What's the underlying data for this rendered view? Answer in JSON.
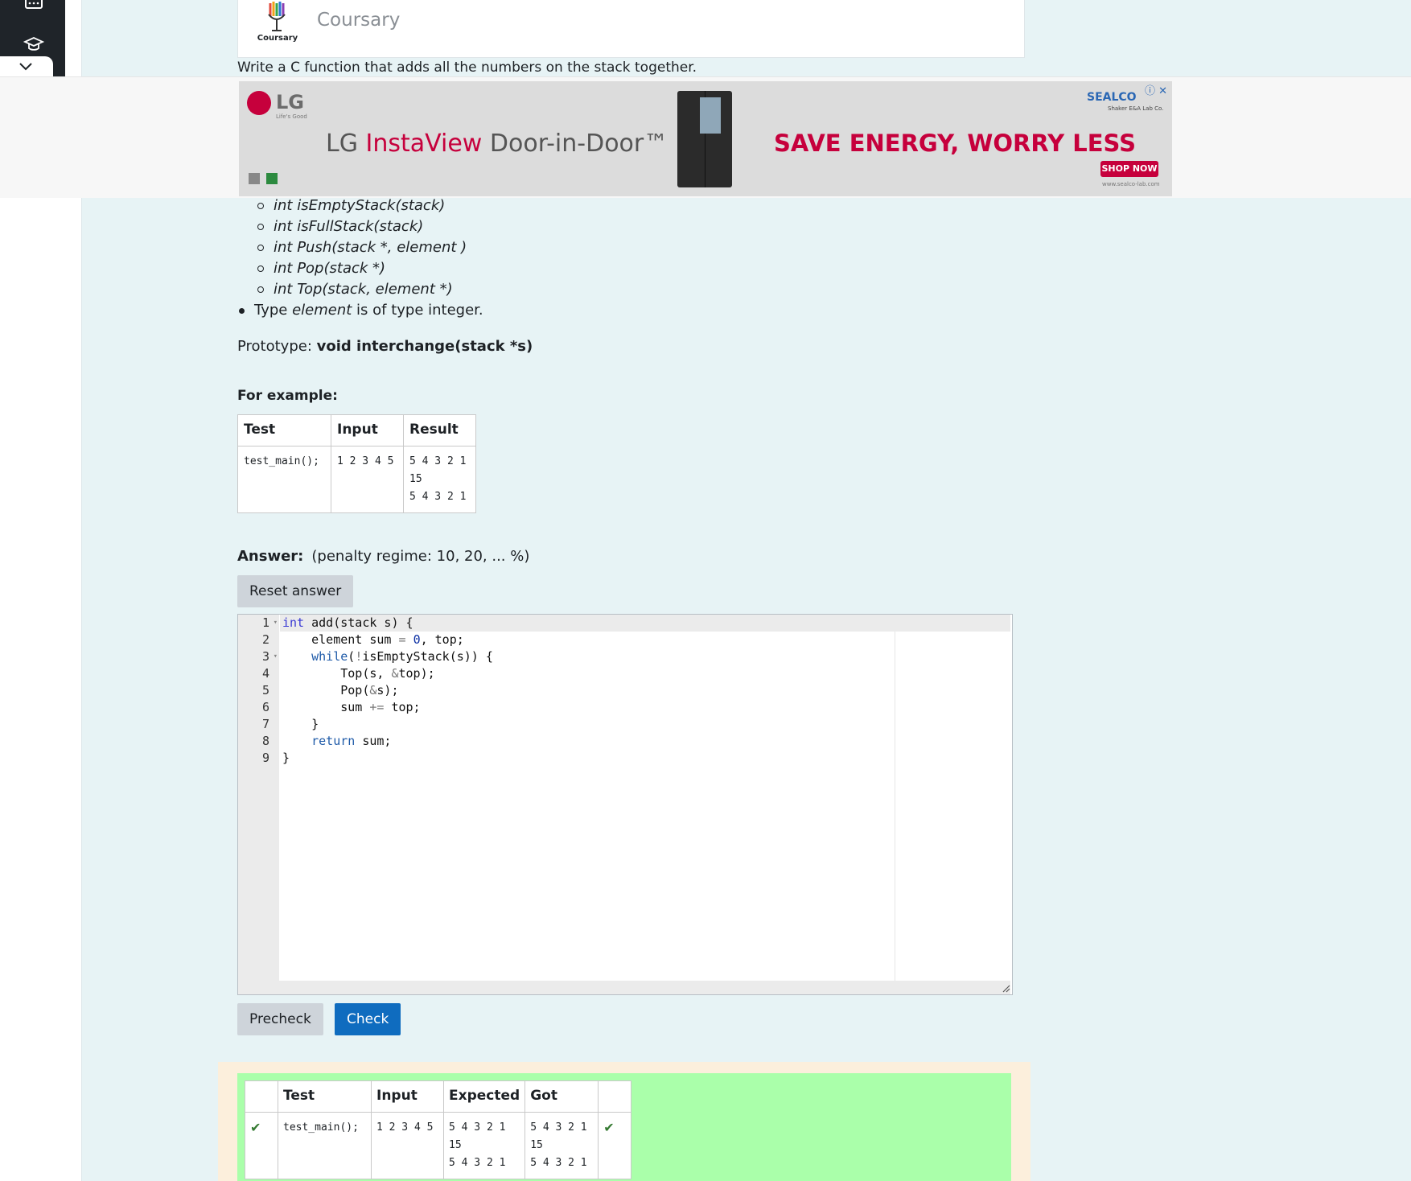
{
  "header": {
    "logo_caption": "Coursary",
    "brand": "Coursary"
  },
  "intro": "Write a C function that adds all the numbers on the stack together.",
  "ad": {
    "brand": "LG",
    "brand_sub": "Life's Good",
    "product_prefix": "LG ",
    "product_highlight": "InstaView",
    "product_suffix": " Door-in-Door™",
    "slogan": "SAVE ENERGY, WORRY LESS",
    "cta": "SHOP NOW",
    "sponsor": "SEALCO",
    "sponsor_sub": "Shaker E&A Lab Co.",
    "url": "www.sealco-lab.com",
    "icons": "ⓘ ✕",
    "accent": "#c6003c"
  },
  "functions": [
    "int isEmptyStack(stack)",
    "int isFullStack(stack)",
    "int Push(stack *, element )",
    "int Pop(stack *)",
    "int Top(stack, element *)"
  ],
  "type_line": {
    "prefix": "Type ",
    "word": "element",
    "suffix": " is of type integer."
  },
  "prototype": {
    "label": "Prototype: ",
    "value": "void interchange(stack *s)"
  },
  "for_example": "For example:",
  "example_table": {
    "headers": [
      "Test",
      "Input",
      "Result"
    ],
    "test": "test_main();",
    "input": "1 2 3 4 5",
    "result": [
      "5 4 3 2 1",
      "15",
      "5 4 3 2 1"
    ]
  },
  "answer": {
    "label": "Answer:",
    "penalty": "(penalty regime: 10, 20, ... %)"
  },
  "buttons": {
    "reset": "Reset answer",
    "precheck": "Precheck",
    "check": "Check",
    "check_color": "#0f6cbf"
  },
  "editor": {
    "line_numbers": [
      "1",
      "2",
      "3",
      "4",
      "5",
      "6",
      "7",
      "8",
      "9"
    ]
  },
  "results_table": {
    "headers": [
      "",
      "Test",
      "Input",
      "Expected",
      "Got",
      ""
    ],
    "test": "test_main();",
    "input": "1 2 3 4 5",
    "expected": [
      "5 4 3 2 1",
      "15",
      "5 4 3 2 1"
    ],
    "got": [
      "5 4 3 2 1",
      "15",
      "5 4 3 2 1"
    ],
    "pass_color": "#aaffaa"
  }
}
